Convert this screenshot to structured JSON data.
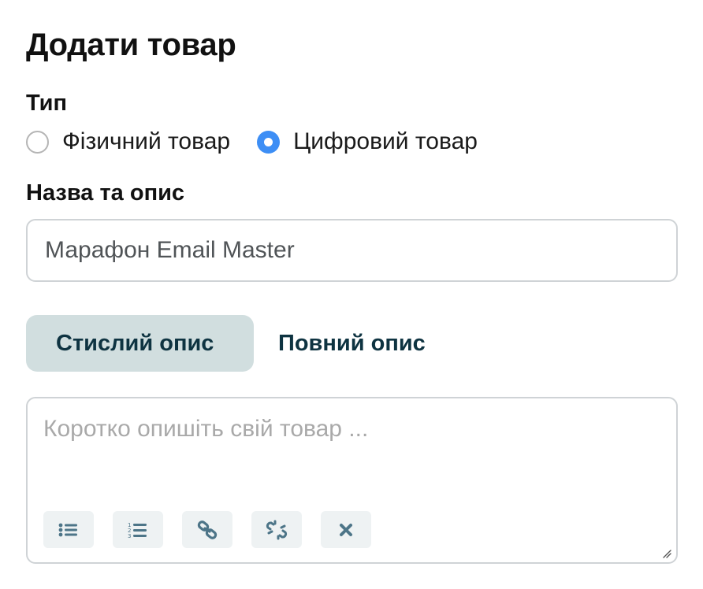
{
  "page": {
    "title": "Додати товар"
  },
  "type_section": {
    "label": "Тип",
    "options": [
      {
        "label": "Фізичний товар",
        "checked": false
      },
      {
        "label": "Цифровий товар",
        "checked": true
      }
    ]
  },
  "name_section": {
    "label": "Назва та опис",
    "name_value": "Марафон Email Master"
  },
  "tabs": [
    {
      "label": "Стислий опис",
      "active": true
    },
    {
      "label": "Повний опис",
      "active": false
    }
  ],
  "description": {
    "placeholder": "Коротко опишіть свій товар ...",
    "value": "",
    "toolbar": [
      {
        "icon": "bulleted-list-icon"
      },
      {
        "icon": "numbered-list-icon"
      },
      {
        "icon": "link-icon"
      },
      {
        "icon": "unlink-icon"
      },
      {
        "icon": "clear-format-icon"
      }
    ]
  },
  "colors": {
    "accent_radio": "#3d8ef5",
    "tab_active_bg": "#d1dedf",
    "tab_text": "#0e3341",
    "toolbar_icon": "#4d7588",
    "toolbar_bg": "#eef2f3"
  }
}
